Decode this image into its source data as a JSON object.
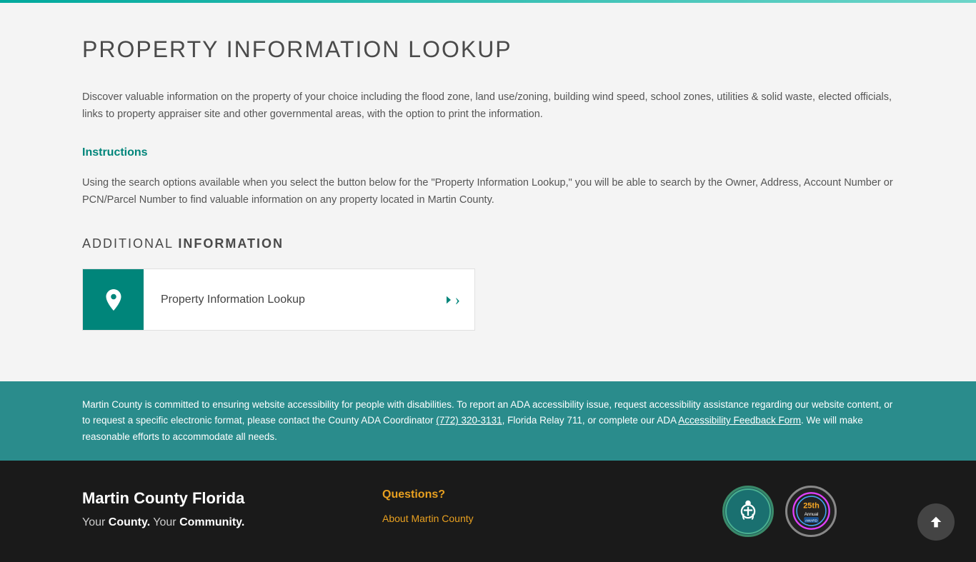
{
  "topbar": {},
  "main": {
    "page_title": "PROPERTY INFORMATION LOOKUP",
    "description": "Discover valuable information on the property of your choice including the flood zone, land use/zoning, building wind speed, school zones, utilities & solid waste, elected officials, links to property appraiser site and other governmental areas, with the option to print the information.",
    "instructions_heading": "Instructions",
    "instructions_text": "Using the search options available when you select the button below for the \"Property Information Lookup,\" you will be able to search by the Owner, Address, Account Number or PCN/Parcel Number to find valuable information on any property located in Martin County.",
    "additional_info_heading_light": "ADDITIONAL ",
    "additional_info_heading_bold": "INFORMATION",
    "lookup_card_label": "Property Information Lookup"
  },
  "accessibility": {
    "text_part1": "Martin County is committed to ensuring website accessibility for people with disabilities. To report an ADA accessibility issue, request accessibility assistance regarding our website content, or to request a specific electronic format, please contact the County ADA Coordinator ",
    "phone": "(772) 320-3131",
    "text_part2": ", Florida Relay 711, or complete our ADA ",
    "feedback_link_text": "Accessibility Feedback Form",
    "text_part3": ". We will make reasonable efforts to accommodate all needs."
  },
  "footer": {
    "brand_title": "Martin County Florida",
    "brand_subtitle_prefix": "Your ",
    "brand_subtitle_bold1": "County.",
    "brand_subtitle_middle": " Your ",
    "brand_subtitle_bold2": "Community.",
    "questions_heading": "Questions?",
    "questions_links": [
      {
        "label": "About Martin County",
        "href": "#"
      }
    ],
    "badge_ada_lines": [
      "ADA",
      "ACCESSIBLE"
    ],
    "badge_25th_lines": [
      "25th",
      "Annual"
    ]
  }
}
